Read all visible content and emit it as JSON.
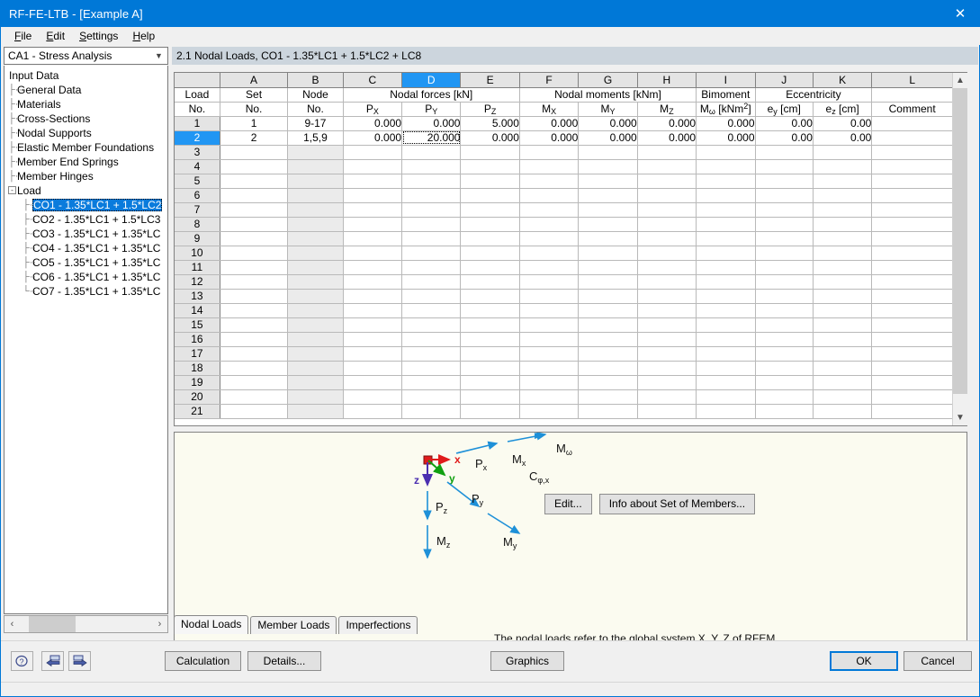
{
  "window": {
    "title": "RF-FE-LTB - [Example A]",
    "close_icon": "close-icon"
  },
  "menu": {
    "items": [
      "File",
      "Edit",
      "Settings",
      "Help"
    ]
  },
  "sidebar": {
    "combo": {
      "value": "CA1 - Stress Analysis",
      "icon": "chevron-down-icon"
    },
    "tree": [
      {
        "label": "Input Data",
        "level": 0,
        "selected": false
      },
      {
        "label": "General Data",
        "level": 1,
        "selected": false
      },
      {
        "label": "Materials",
        "level": 1,
        "selected": false
      },
      {
        "label": "Cross-Sections",
        "level": 1,
        "selected": false
      },
      {
        "label": "Nodal Supports",
        "level": 1,
        "selected": false
      },
      {
        "label": "Elastic Member Foundations",
        "level": 1,
        "selected": false
      },
      {
        "label": "Member End Springs",
        "level": 1,
        "selected": false
      },
      {
        "label": "Member Hinges",
        "level": 1,
        "selected": false
      },
      {
        "label": "Load",
        "level": 1,
        "selected": false,
        "expander": "-"
      },
      {
        "label": "CO1 - 1.35*LC1 + 1.5*LC2",
        "level": 2,
        "selected": true
      },
      {
        "label": "CO2 - 1.35*LC1 + 1.5*LC3",
        "level": 2,
        "selected": false
      },
      {
        "label": "CO3 - 1.35*LC1 + 1.35*LC",
        "level": 2,
        "selected": false
      },
      {
        "label": "CO4 - 1.35*LC1 + 1.35*LC",
        "level": 2,
        "selected": false
      },
      {
        "label": "CO5 - 1.35*LC1 + 1.35*LC",
        "level": 2,
        "selected": false
      },
      {
        "label": "CO6 - 1.35*LC1 + 1.35*LC",
        "level": 2,
        "selected": false
      },
      {
        "label": "CO7 - 1.35*LC1 + 1.35*LC",
        "level": 2,
        "selected": false
      }
    ],
    "hscroll": {
      "left_icon": "chevron-left-icon",
      "right_icon": "chevron-right-icon"
    }
  },
  "pane": {
    "title": "2.1 Nodal Loads, CO1 - 1.35*LC1 + 1.5*LC2 + LC8"
  },
  "table": {
    "column_letters": [
      "",
      "A",
      "B",
      "C",
      "D",
      "E",
      "F",
      "G",
      "H",
      "I",
      "J",
      "K",
      "L"
    ],
    "active_letter": "D",
    "group_headers": [
      {
        "text": "Nodal forces  [kN]",
        "span": 3
      },
      {
        "text": "Nodal moments  [kNm]",
        "span": 3
      }
    ],
    "headers_line1": [
      "Load",
      "Set",
      "Node",
      "",
      "",
      "",
      "",
      "",
      "",
      "Bimoment",
      "Eccentricity",
      "",
      ""
    ],
    "headers_line2": [
      "No.",
      "No.",
      "No.",
      "P",
      "P",
      "P",
      "M",
      "M",
      "M",
      "M",
      "e",
      "e",
      "Comment"
    ],
    "subscripts": {
      "px": "X",
      "py": "Y",
      "pz": "Z",
      "mx": "X",
      "my": "Y",
      "mz": "Z",
      "mw": "ω",
      "ey": "y",
      "ez": "z"
    },
    "bimoment_unit": "[kNm",
    "bimoment_exp": "2",
    "bimoment_unit_end": "]",
    "ecc_y_unit": "[cm]",
    "ecc_z_unit": "[cm]",
    "comment_label": "Comment",
    "rows": [
      {
        "no": "1",
        "set": "1",
        "node": "9-17",
        "px": "0.000",
        "py": "0.000",
        "pz": "5.000",
        "mx": "0.000",
        "my": "0.000",
        "mz": "0.000",
        "mw": "0.000",
        "ey": "0.00",
        "ez": "0.00",
        "comment": "",
        "selected": false
      },
      {
        "no": "2",
        "set": "2",
        "node": "1,5,9",
        "px": "0.000",
        "py": "20.000",
        "pz": "0.000",
        "mx": "0.000",
        "my": "0.000",
        "mz": "0.000",
        "mw": "0.000",
        "ey": "0.00",
        "ez": "0.00",
        "comment": "",
        "selected": true
      }
    ],
    "empty_row_numbers": [
      "3",
      "4",
      "5",
      "6",
      "7",
      "8",
      "9",
      "10",
      "11",
      "12",
      "13",
      "14",
      "15",
      "16",
      "17",
      "18",
      "19",
      "20",
      "21"
    ],
    "focused_cell": "D2",
    "scroll_up_icon": "chevron-up-icon",
    "scroll_down_icon": "chevron-down-icon"
  },
  "diagram": {
    "edit_button": "Edit...",
    "info_button": "Info about Set of Members...",
    "axes": [
      {
        "label": "x",
        "color": "#e01b1b"
      },
      {
        "label": "y",
        "color": "#11a011"
      },
      {
        "label": "z",
        "color": "#4b2fb0"
      }
    ],
    "load_labels": [
      "P",
      "M",
      "M",
      "C",
      "P",
      "P",
      "M",
      "M"
    ],
    "labels": {
      "px": "P",
      "px_sub": "x",
      "mx": "M",
      "mx_sub": "x",
      "mw": "M",
      "mw_sub": "ω",
      "cphix": "C",
      "cphix_sub": "φ,x",
      "pz": "P",
      "pz_sub": "z",
      "py": "P",
      "py_sub": "y",
      "my": "M",
      "my_sub": "y",
      "mz": "M",
      "mz_sub": "z"
    },
    "note": "The nodal loads refer to the global system X, Y, Z of RFEM.",
    "arrow_color": "#1e90d8"
  },
  "tabs": {
    "items": [
      "Nodal Loads",
      "Member Loads",
      "Imperfections"
    ],
    "active": "Nodal Loads"
  },
  "bottom": {
    "icons": [
      "help-icon",
      "previous-icon",
      "next-icon"
    ],
    "calculation": "Calculation",
    "details": "Details...",
    "graphics": "Graphics",
    "ok": "OK",
    "cancel": "Cancel"
  },
  "colors": {
    "accent": "#0078d7",
    "header_active": "#2196f3",
    "diagram_bg": "#fbfbf0"
  }
}
